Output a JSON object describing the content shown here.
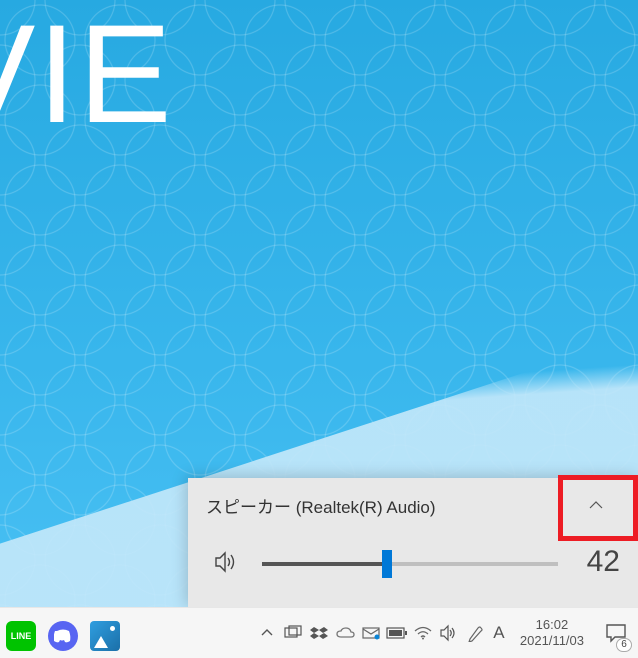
{
  "wallpaper": {
    "brand_text": "VIE"
  },
  "volume_flyout": {
    "device_name": "スピーカー (Realtek(R) Audio)",
    "level": 42,
    "level_text": "42",
    "expand_highlighted": true
  },
  "taskbar": {
    "apps": [
      {
        "name": "line",
        "label": "LINE",
        "active": true,
        "accent": "#00c300"
      },
      {
        "name": "discord",
        "label": "Discord",
        "active": true,
        "accent": "#5865f2"
      },
      {
        "name": "photos",
        "label": "Photos",
        "active": true,
        "accent": "#0b94d8"
      }
    ]
  },
  "tray": {
    "icons": [
      "overflow-chevron",
      "task-view",
      "dropbox",
      "onedrive",
      "mail",
      "battery",
      "wifi",
      "volume",
      "pen",
      "ime-a"
    ],
    "ime_label": "A"
  },
  "clock": {
    "time": "16:02",
    "date": "2021/11/03"
  },
  "action_center": {
    "badge": "6"
  }
}
